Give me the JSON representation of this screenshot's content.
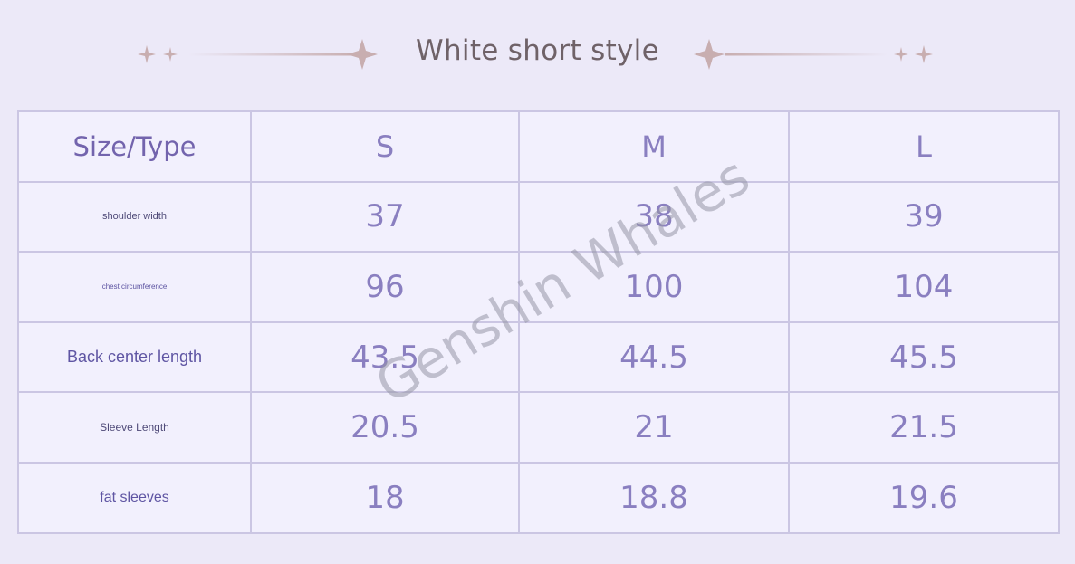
{
  "title": "White short style",
  "accent_color": "#7364ad",
  "decoration_color": "#c8aeb0",
  "watermark": "Genshin Whales",
  "table": {
    "header": {
      "type_label": "Size/Type",
      "sizes": [
        "S",
        "M",
        "L"
      ]
    },
    "rows": [
      {
        "label": "shoulder width",
        "values": [
          "37",
          "38",
          "39"
        ]
      },
      {
        "label": "chest circumference",
        "values": [
          "96",
          "100",
          "104"
        ]
      },
      {
        "label": "Back center length",
        "values": [
          "43.5",
          "44.5",
          "45.5"
        ]
      },
      {
        "label": "Sleeve Length",
        "values": [
          "20.5",
          "21",
          "21.5"
        ]
      },
      {
        "label": "fat sleeves",
        "values": [
          "18",
          "18.8",
          "19.6"
        ]
      }
    ]
  }
}
